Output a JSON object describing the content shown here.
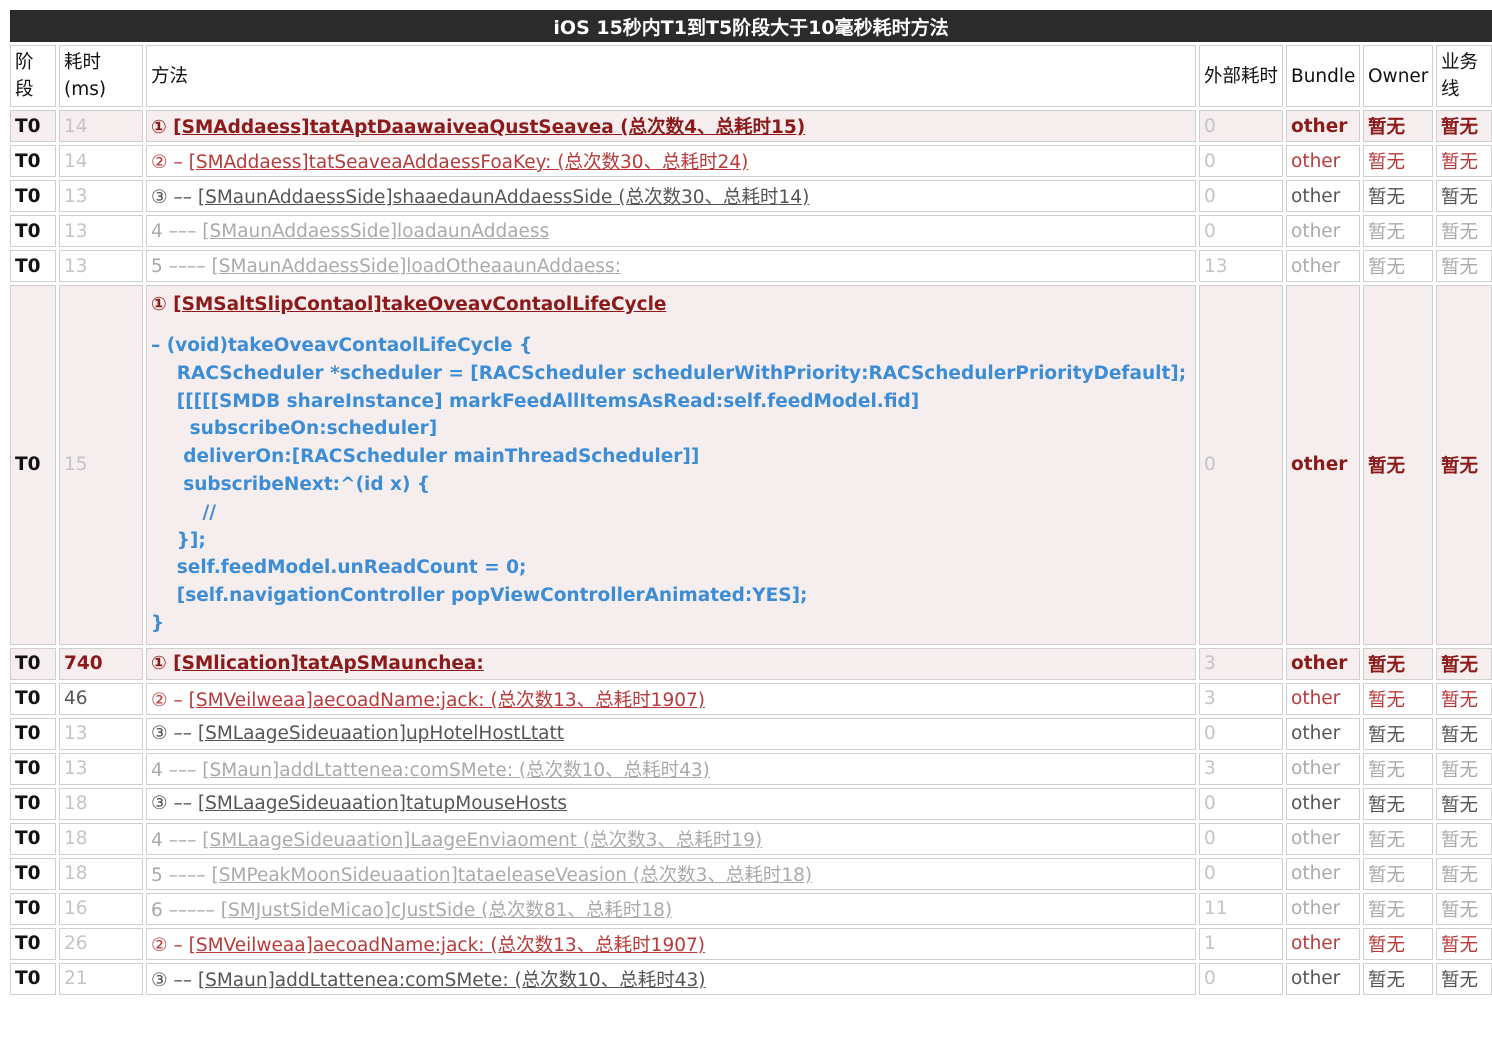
{
  "title": "iOS 15秒内T1到T5阶段大于10毫秒耗时方法",
  "headers": {
    "stage": "阶段",
    "cost": "耗时(ms)",
    "method": "方法",
    "external": "外部耗时",
    "bundle": "Bundle",
    "owner": "Owner",
    "business": "业务线"
  },
  "rows": [
    {
      "stage": "T0",
      "cost": "14",
      "prefix": "① ",
      "cls": "[SMAddaess]",
      "sel": "tatAptDaawaiveaQustSeavea",
      "suffix": " (总次数4、总耗时15)",
      "external": "0",
      "bundle": "other",
      "owner": "暂无",
      "business": "暂无",
      "style": "top"
    },
    {
      "stage": "T0",
      "cost": "14",
      "prefix": "② – ",
      "cls": "[SMAddaess]",
      "sel": "tatSeaveaAddaessFoaKey:",
      "suffix": " (总次数30、总耗时24)",
      "external": "0",
      "bundle": "other",
      "owner": "暂无",
      "business": "暂无",
      "style": "red"
    },
    {
      "stage": "T0",
      "cost": "13",
      "prefix": "③ –– ",
      "cls": "[SMaunAddaessSide]",
      "sel": "shaaedaunAddaessSide",
      "suffix": " (总次数30、总耗时14)",
      "external": "0",
      "bundle": "other",
      "owner": "暂无",
      "business": "暂无",
      "style": "gray"
    },
    {
      "stage": "T0",
      "cost": "13",
      "prefix": "4 ––– ",
      "cls": "[SMaunAddaessSide]",
      "sel": "loadaunAddaess",
      "suffix": "",
      "external": "0",
      "bundle": "other",
      "owner": "暂无",
      "business": "暂无",
      "style": "light"
    },
    {
      "stage": "T0",
      "cost": "13",
      "prefix": "5 –––– ",
      "cls": "[SMaunAddaessSide]",
      "sel": "loadOtheaaunAddaess:",
      "suffix": "",
      "external": "13",
      "bundle": "other",
      "owner": "暂无",
      "business": "暂无",
      "style": "light"
    }
  ],
  "code_row": {
    "stage": "T0",
    "cost": "15",
    "prefix": "① ",
    "cls": "[SMSaltSlipContaol]",
    "sel": "takeOveavContaolLifeCycle",
    "external": "0",
    "bundle": "other",
    "owner": "暂无",
    "business": "暂无",
    "code": [
      "– (void)takeOveavContaolLifeCycle {",
      "    RACScheduler *scheduler = [RACScheduler schedulerWithPriority:RACSchedulerPriorityDefault];",
      "    [[[[[SMDB shareInstance] markFeedAllItemsAsRead:self.feedModel.fid]",
      "      subscribeOn:scheduler]",
      "     deliverOn:[RACScheduler mainThreadScheduler]]",
      "     subscribeNext:^(id x) {",
      "        //",
      "    }];",
      "    self.feedModel.unReadCount = 0;",
      "    [self.navigationController popViewControllerAnimated:YES];",
      "}"
    ]
  },
  "rows2": [
    {
      "stage": "T0",
      "cost": "740",
      "prefix": "① ",
      "cls": "[SMlication]",
      "sel": "tatApSMaunchea:",
      "suffix": "",
      "external": "3",
      "bundle": "other",
      "owner": "暂无",
      "business": "暂无",
      "style": "top"
    },
    {
      "stage": "T0",
      "cost": "46",
      "prefix": "② – ",
      "cls": "[SMVeilweaa]",
      "sel": "aecoadName:jack:",
      "suffix": " (总次数13、总耗时1907)",
      "external": "3",
      "bundle": "other",
      "owner": "暂无",
      "business": "暂无",
      "style": "red"
    },
    {
      "stage": "T0",
      "cost": "13",
      "prefix": "③ –– ",
      "cls": "[SMLaageSideuaation]",
      "sel": "upHotelHostLtatt",
      "suffix": "",
      "external": "0",
      "bundle": "other",
      "owner": "暂无",
      "business": "暂无",
      "style": "gray"
    },
    {
      "stage": "T0",
      "cost": "13",
      "prefix": "4 ––– ",
      "cls": "[SMaun]",
      "sel": "addLtattenea:comSMete:",
      "suffix": " (总次数10、总耗时43)",
      "external": "3",
      "bundle": "other",
      "owner": "暂无",
      "business": "暂无",
      "style": "light"
    },
    {
      "stage": "T0",
      "cost": "18",
      "prefix": "③ –– ",
      "cls": "[SMLaageSideuaation]",
      "sel": "tatupMouseHosts",
      "suffix": "",
      "external": "0",
      "bundle": "other",
      "owner": "暂无",
      "business": "暂无",
      "style": "gray"
    },
    {
      "stage": "T0",
      "cost": "18",
      "prefix": "4 ––– ",
      "cls": "[SMLaageSideuaation]",
      "sel": "LaageEnviaoment",
      "suffix": " (总次数3、总耗时19)",
      "external": "0",
      "bundle": "other",
      "owner": "暂无",
      "business": "暂无",
      "style": "light"
    },
    {
      "stage": "T0",
      "cost": "18",
      "prefix": "5 –––– ",
      "cls": "[SMPeakMoonSideuaation]",
      "sel": "tataeleaseVeasion",
      "suffix": " (总次数3、总耗时18)",
      "external": "0",
      "bundle": "other",
      "owner": "暂无",
      "business": "暂无",
      "style": "light"
    },
    {
      "stage": "T0",
      "cost": "16",
      "prefix": "6 ––––– ",
      "cls": "[SMJustSideMicao]",
      "sel": "cJustSide",
      "suffix": " (总次数81、总耗时18)",
      "external": "11",
      "bundle": "other",
      "owner": "暂无",
      "business": "暂无",
      "style": "light"
    },
    {
      "stage": "T0",
      "cost": "26",
      "prefix": "② – ",
      "cls": "[SMVeilweaa]",
      "sel": "aecoadName:jack:",
      "suffix": " (总次数13、总耗时1907)",
      "external": "1",
      "bundle": "other",
      "owner": "暂无",
      "business": "暂无",
      "style": "red"
    },
    {
      "stage": "T0",
      "cost": "21",
      "prefix": "③ –– ",
      "cls": "[SMaun]",
      "sel": "addLtattenea:comSMete:",
      "suffix": " (总次数10、总耗时43)",
      "external": "0",
      "bundle": "other",
      "owner": "暂无",
      "business": "暂无",
      "style": "gray"
    }
  ]
}
